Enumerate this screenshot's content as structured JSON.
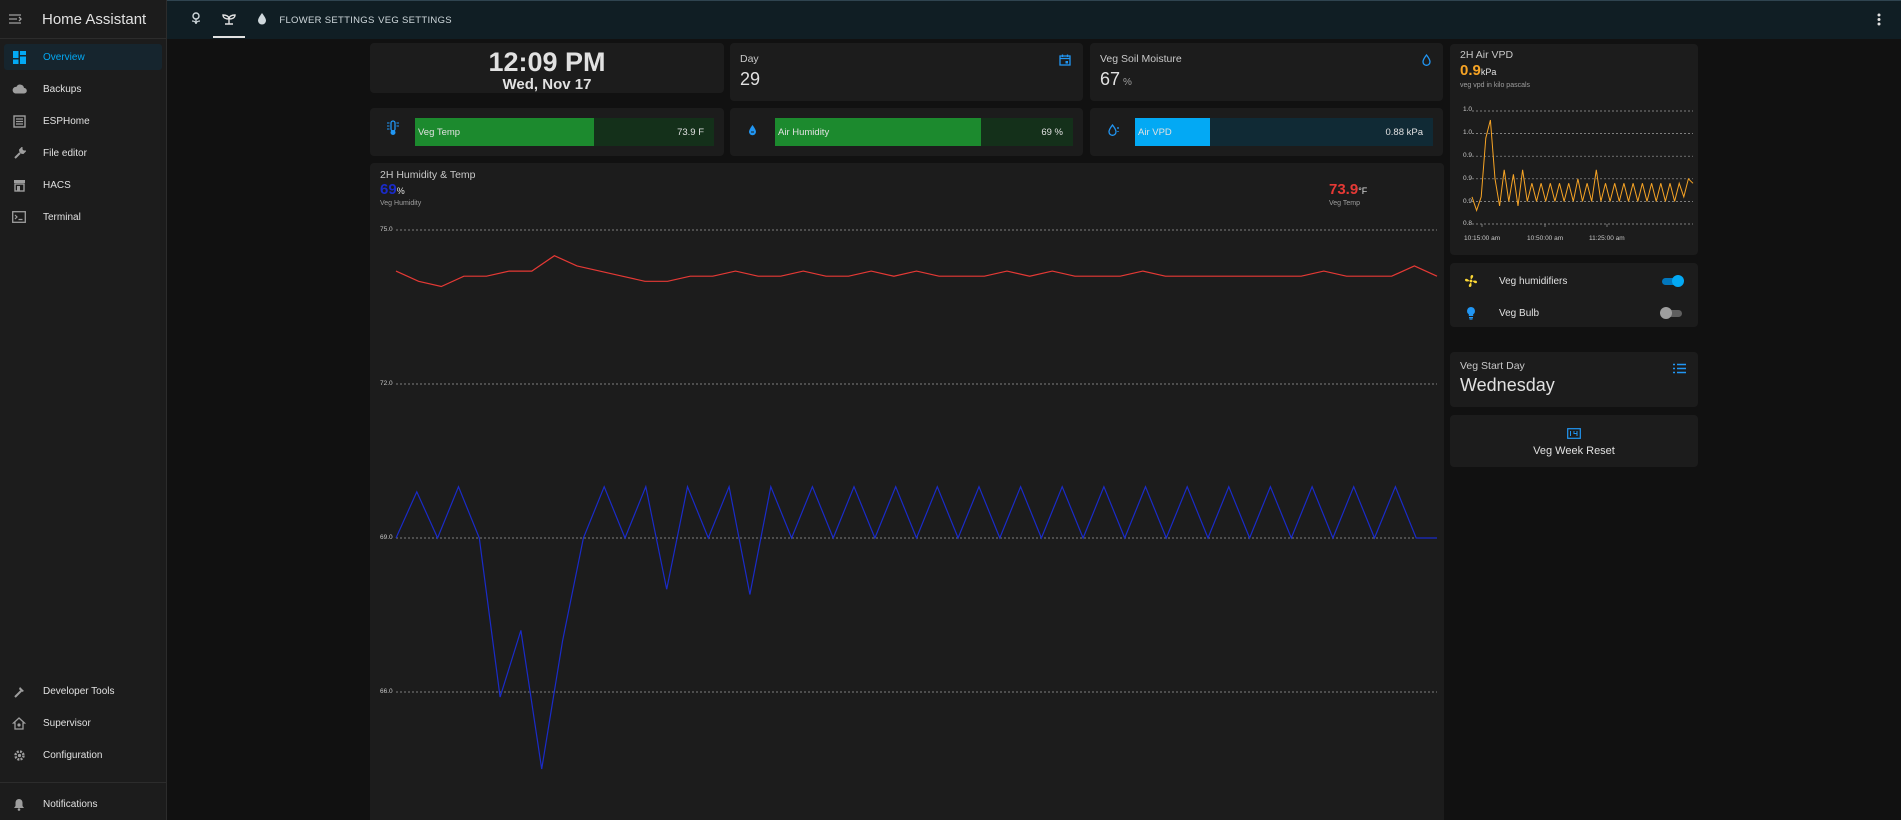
{
  "app": {
    "title": "Home Assistant"
  },
  "sidebar": {
    "items": [
      {
        "label": "Overview",
        "icon": "dashboard-icon"
      },
      {
        "label": "Backups",
        "icon": "cloud-icon"
      },
      {
        "label": "ESPHome",
        "icon": "esphome-icon"
      },
      {
        "label": "File editor",
        "icon": "wrench-icon"
      },
      {
        "label": "HACS",
        "icon": "store-icon"
      },
      {
        "label": "Terminal",
        "icon": "console-icon"
      }
    ],
    "bottom_items": [
      {
        "label": "Developer Tools",
        "icon": "hammer-icon"
      },
      {
        "label": "Supervisor",
        "icon": "supervisor-icon"
      },
      {
        "label": "Configuration",
        "icon": "gear-icon"
      }
    ],
    "notifications": "Notifications"
  },
  "topbar": {
    "icon_tabs": [
      "flower-icon",
      "sprout-icon",
      "water-drop-icon"
    ],
    "tabs": [
      "FLOWER SETTINGS",
      "VEG SETTINGS"
    ]
  },
  "clock": {
    "time": "12:09 PM",
    "date": "Wed, Nov 17"
  },
  "day_card": {
    "name": "Day",
    "value": "29"
  },
  "soil_card": {
    "name": "Veg Soil Moisture",
    "value": "67",
    "unit": "%"
  },
  "bars": [
    {
      "name": "Veg Temp",
      "value": "73.9 F",
      "fraction": 0.6,
      "color": "#1c8a2e",
      "track": "#14301a",
      "icon": "thermometer-icon"
    },
    {
      "name": "Air Humidity",
      "value": "69 %",
      "fraction": 0.69,
      "color": "#1c8a2e",
      "track": "#14301a",
      "icon": "humidity-icon"
    },
    {
      "name": "Air VPD",
      "value": "0.88 kPa",
      "fraction": 0.25,
      "color": "#03a9f4",
      "track": "#102a35",
      "icon": "water-percent-icon"
    }
  ],
  "humidity_temp": {
    "title": "2H Humidity & Temp",
    "humidity": {
      "value": "69",
      "unit": "%",
      "name": "Veg Humidity",
      "color": "#1a2bc8"
    },
    "temp": {
      "value": "73.9",
      "unit": "°F",
      "name": "Veg Temp",
      "color": "#e53935"
    },
    "ticks": [
      "75.0",
      "72.0",
      "69.0",
      "66.0"
    ]
  },
  "vpd_card": {
    "title": "2H Air VPD",
    "value": "0.9",
    "unit": "kPa",
    "subtitle": "veg vpd in kilo pascals",
    "color": "#f7a425",
    "y_ticks": [
      "1.0",
      "1.0",
      "0.9",
      "0.9",
      "0.9",
      "0.8"
    ],
    "x_ticks": [
      "10:15:00 am",
      "10:50:00 am",
      "11:25:00 am"
    ]
  },
  "toggles": [
    {
      "name": "Veg humidifiers",
      "on": true,
      "icon": "fan-icon",
      "icon_color": "#fdd835"
    },
    {
      "name": "Veg Bulb",
      "on": false,
      "icon": "lightbulb-icon",
      "icon_color": "#2196f3"
    }
  ],
  "start_day": {
    "name": "Veg Start Day",
    "value": "Wednesday"
  },
  "reset": {
    "label": "Veg Week Reset"
  },
  "chart_data": [
    {
      "type": "line",
      "title": "2H Humidity & Temp",
      "ylim": [
        64.0,
        76.0
      ],
      "y_ticks": [
        75.0,
        72.0,
        69.0,
        66.0
      ],
      "series": [
        {
          "name": "Veg Temp",
          "color": "#e53935",
          "values": [
            74.2,
            74.0,
            73.9,
            74.1,
            74.1,
            74.2,
            74.2,
            74.5,
            74.3,
            74.2,
            74.1,
            74.0,
            74.0,
            74.1,
            74.1,
            74.2,
            74.1,
            74.1,
            74.2,
            74.1,
            74.1,
            74.2,
            74.1,
            74.2,
            74.1,
            74.1,
            74.1,
            74.2,
            74.1,
            74.2,
            74.1,
            74.1,
            74.1,
            74.2,
            74.1,
            74.1,
            74.1,
            74.1,
            74.1,
            74.1,
            74.1,
            74.2,
            74.1,
            74.1,
            74.1,
            74.3,
            74.1
          ]
        },
        {
          "name": "Veg Humidity",
          "color": "#1a2bc8",
          "values": [
            69.0,
            69.9,
            69.0,
            70.0,
            69.0,
            65.9,
            67.2,
            64.5,
            67.0,
            69.0,
            70.0,
            69.0,
            70.0,
            68.0,
            70.0,
            69.0,
            70.0,
            67.9,
            70.0,
            69.0,
            70.0,
            69.0,
            70.0,
            69.0,
            70.0,
            69.0,
            70.0,
            69.0,
            70.0,
            69.0,
            70.0,
            69.0,
            70.0,
            69.0,
            70.0,
            69.0,
            70.0,
            69.0,
            70.0,
            69.0,
            70.0,
            69.0,
            70.0,
            69.0,
            70.0,
            69.0,
            70.0,
            69.0,
            70.0,
            69.0,
            69.0
          ]
        }
      ]
    },
    {
      "type": "line",
      "title": "2H Air VPD",
      "ylim": [
        0.8,
        1.05
      ],
      "y_ticks": [
        "1.0",
        "1.0",
        "0.9",
        "0.9",
        "0.9",
        "0.8"
      ],
      "x_ticks": [
        "10:15:00 am",
        "10:50:00 am",
        "11:25:00 am"
      ],
      "series": [
        {
          "name": "veg vpd",
          "color": "#f7a425",
          "values": [
            0.86,
            0.83,
            0.86,
            0.99,
            1.03,
            0.9,
            0.84,
            0.92,
            0.85,
            0.91,
            0.84,
            0.92,
            0.85,
            0.89,
            0.85,
            0.89,
            0.85,
            0.89,
            0.85,
            0.89,
            0.85,
            0.89,
            0.85,
            0.9,
            0.85,
            0.89,
            0.85,
            0.92,
            0.85,
            0.89,
            0.85,
            0.89,
            0.85,
            0.89,
            0.85,
            0.89,
            0.85,
            0.89,
            0.85,
            0.89,
            0.85,
            0.89,
            0.85,
            0.89,
            0.85,
            0.89,
            0.86,
            0.9,
            0.89
          ]
        }
      ]
    }
  ]
}
